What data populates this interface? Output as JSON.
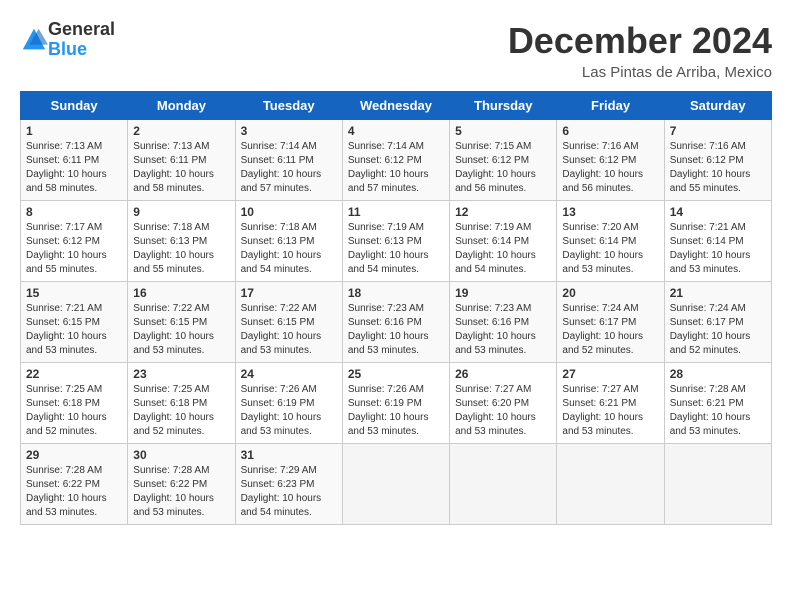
{
  "logo": {
    "general": "General",
    "blue": "Blue"
  },
  "title": "December 2024",
  "subtitle": "Las Pintas de Arriba, Mexico",
  "weekdays": [
    "Sunday",
    "Monday",
    "Tuesday",
    "Wednesday",
    "Thursday",
    "Friday",
    "Saturday"
  ],
  "weeks": [
    [
      {
        "day": "1",
        "sunrise": "Sunrise: 7:13 AM",
        "sunset": "Sunset: 6:11 PM",
        "daylight": "Daylight: 10 hours and 58 minutes."
      },
      {
        "day": "2",
        "sunrise": "Sunrise: 7:13 AM",
        "sunset": "Sunset: 6:11 PM",
        "daylight": "Daylight: 10 hours and 58 minutes."
      },
      {
        "day": "3",
        "sunrise": "Sunrise: 7:14 AM",
        "sunset": "Sunset: 6:11 PM",
        "daylight": "Daylight: 10 hours and 57 minutes."
      },
      {
        "day": "4",
        "sunrise": "Sunrise: 7:14 AM",
        "sunset": "Sunset: 6:12 PM",
        "daylight": "Daylight: 10 hours and 57 minutes."
      },
      {
        "day": "5",
        "sunrise": "Sunrise: 7:15 AM",
        "sunset": "Sunset: 6:12 PM",
        "daylight": "Daylight: 10 hours and 56 minutes."
      },
      {
        "day": "6",
        "sunrise": "Sunrise: 7:16 AM",
        "sunset": "Sunset: 6:12 PM",
        "daylight": "Daylight: 10 hours and 56 minutes."
      },
      {
        "day": "7",
        "sunrise": "Sunrise: 7:16 AM",
        "sunset": "Sunset: 6:12 PM",
        "daylight": "Daylight: 10 hours and 55 minutes."
      }
    ],
    [
      {
        "day": "8",
        "sunrise": "Sunrise: 7:17 AM",
        "sunset": "Sunset: 6:12 PM",
        "daylight": "Daylight: 10 hours and 55 minutes."
      },
      {
        "day": "9",
        "sunrise": "Sunrise: 7:18 AM",
        "sunset": "Sunset: 6:13 PM",
        "daylight": "Daylight: 10 hours and 55 minutes."
      },
      {
        "day": "10",
        "sunrise": "Sunrise: 7:18 AM",
        "sunset": "Sunset: 6:13 PM",
        "daylight": "Daylight: 10 hours and 54 minutes."
      },
      {
        "day": "11",
        "sunrise": "Sunrise: 7:19 AM",
        "sunset": "Sunset: 6:13 PM",
        "daylight": "Daylight: 10 hours and 54 minutes."
      },
      {
        "day": "12",
        "sunrise": "Sunrise: 7:19 AM",
        "sunset": "Sunset: 6:14 PM",
        "daylight": "Daylight: 10 hours and 54 minutes."
      },
      {
        "day": "13",
        "sunrise": "Sunrise: 7:20 AM",
        "sunset": "Sunset: 6:14 PM",
        "daylight": "Daylight: 10 hours and 53 minutes."
      },
      {
        "day": "14",
        "sunrise": "Sunrise: 7:21 AM",
        "sunset": "Sunset: 6:14 PM",
        "daylight": "Daylight: 10 hours and 53 minutes."
      }
    ],
    [
      {
        "day": "15",
        "sunrise": "Sunrise: 7:21 AM",
        "sunset": "Sunset: 6:15 PM",
        "daylight": "Daylight: 10 hours and 53 minutes."
      },
      {
        "day": "16",
        "sunrise": "Sunrise: 7:22 AM",
        "sunset": "Sunset: 6:15 PM",
        "daylight": "Daylight: 10 hours and 53 minutes."
      },
      {
        "day": "17",
        "sunrise": "Sunrise: 7:22 AM",
        "sunset": "Sunset: 6:15 PM",
        "daylight": "Daylight: 10 hours and 53 minutes."
      },
      {
        "day": "18",
        "sunrise": "Sunrise: 7:23 AM",
        "sunset": "Sunset: 6:16 PM",
        "daylight": "Daylight: 10 hours and 53 minutes."
      },
      {
        "day": "19",
        "sunrise": "Sunrise: 7:23 AM",
        "sunset": "Sunset: 6:16 PM",
        "daylight": "Daylight: 10 hours and 53 minutes."
      },
      {
        "day": "20",
        "sunrise": "Sunrise: 7:24 AM",
        "sunset": "Sunset: 6:17 PM",
        "daylight": "Daylight: 10 hours and 52 minutes."
      },
      {
        "day": "21",
        "sunrise": "Sunrise: 7:24 AM",
        "sunset": "Sunset: 6:17 PM",
        "daylight": "Daylight: 10 hours and 52 minutes."
      }
    ],
    [
      {
        "day": "22",
        "sunrise": "Sunrise: 7:25 AM",
        "sunset": "Sunset: 6:18 PM",
        "daylight": "Daylight: 10 hours and 52 minutes."
      },
      {
        "day": "23",
        "sunrise": "Sunrise: 7:25 AM",
        "sunset": "Sunset: 6:18 PM",
        "daylight": "Daylight: 10 hours and 52 minutes."
      },
      {
        "day": "24",
        "sunrise": "Sunrise: 7:26 AM",
        "sunset": "Sunset: 6:19 PM",
        "daylight": "Daylight: 10 hours and 53 minutes."
      },
      {
        "day": "25",
        "sunrise": "Sunrise: 7:26 AM",
        "sunset": "Sunset: 6:19 PM",
        "daylight": "Daylight: 10 hours and 53 minutes."
      },
      {
        "day": "26",
        "sunrise": "Sunrise: 7:27 AM",
        "sunset": "Sunset: 6:20 PM",
        "daylight": "Daylight: 10 hours and 53 minutes."
      },
      {
        "day": "27",
        "sunrise": "Sunrise: 7:27 AM",
        "sunset": "Sunset: 6:21 PM",
        "daylight": "Daylight: 10 hours and 53 minutes."
      },
      {
        "day": "28",
        "sunrise": "Sunrise: 7:28 AM",
        "sunset": "Sunset: 6:21 PM",
        "daylight": "Daylight: 10 hours and 53 minutes."
      }
    ],
    [
      {
        "day": "29",
        "sunrise": "Sunrise: 7:28 AM",
        "sunset": "Sunset: 6:22 PM",
        "daylight": "Daylight: 10 hours and 53 minutes."
      },
      {
        "day": "30",
        "sunrise": "Sunrise: 7:28 AM",
        "sunset": "Sunset: 6:22 PM",
        "daylight": "Daylight: 10 hours and 53 minutes."
      },
      {
        "day": "31",
        "sunrise": "Sunrise: 7:29 AM",
        "sunset": "Sunset: 6:23 PM",
        "daylight": "Daylight: 10 hours and 54 minutes."
      },
      null,
      null,
      null,
      null
    ]
  ]
}
